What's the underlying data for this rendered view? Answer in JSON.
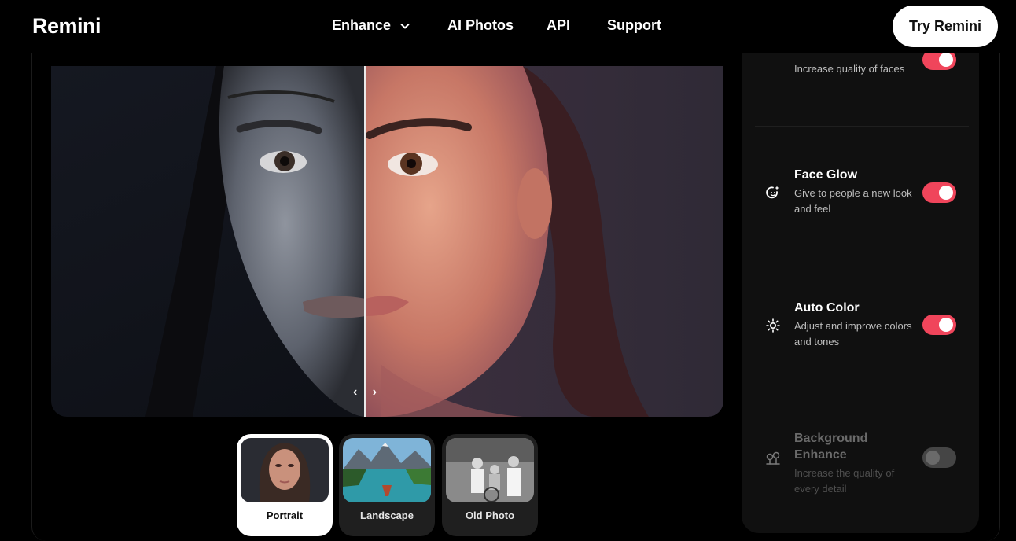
{
  "nav": {
    "logo": "Remini",
    "links": [
      "Enhance",
      "AI Photos",
      "API",
      "Support"
    ],
    "cta": "Try Remini"
  },
  "thumbnails": [
    {
      "label": "Portrait",
      "active": true
    },
    {
      "label": "Landscape",
      "active": false
    },
    {
      "label": "Old Photo",
      "active": false
    }
  ],
  "features": [
    {
      "title": "",
      "description": "Increase quality of faces",
      "enabled": true,
      "icon": "face-icon"
    },
    {
      "title": "Face Glow",
      "description": "Give to people a new look and feel",
      "enabled": true,
      "icon": "sparkle-circle-icon"
    },
    {
      "title": "Auto Color",
      "description": "Adjust and improve colors and tones",
      "enabled": true,
      "icon": "sun-icon"
    },
    {
      "title": "Background Enhance",
      "description": "Increase the quality of every detail",
      "enabled": false,
      "icon": "trees-icon"
    }
  ],
  "colors": {
    "accent": "#f0455b",
    "panel": "#101010",
    "background": "#000000"
  }
}
